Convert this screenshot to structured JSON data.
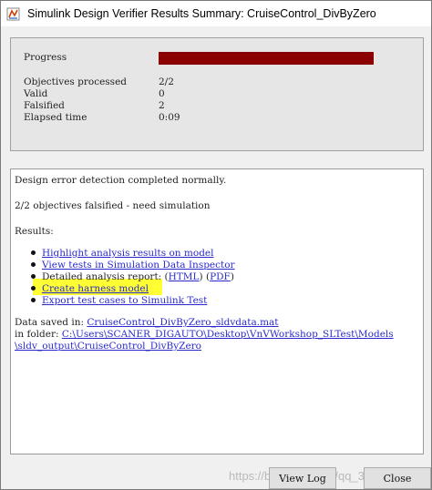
{
  "window": {
    "title": "Simulink Design Verifier Results Summary: CruiseControl_DivByZero",
    "icon": "simulink-icon"
  },
  "summary": {
    "progress_label": "Progress",
    "progress_fraction": 1.0,
    "progress_color": "#8b0000",
    "rows": [
      {
        "label": "Objectives processed",
        "value": "2/2"
      },
      {
        "label": "Valid",
        "value": "0"
      },
      {
        "label": "Falsified",
        "value": "2"
      },
      {
        "label": "Elapsed time",
        "value": "0:09"
      }
    ]
  },
  "log": {
    "line1": "Design error detection completed normally.",
    "line2": "2/2 objectives falsified - need simulation",
    "results_label": "Results:",
    "results": {
      "highlight": "Highlight analysis results on model",
      "view_tests": "View tests in Simulation Data Inspector",
      "report_prefix": "Detailed analysis report: (",
      "report_html": "HTML",
      "report_mid": ") (",
      "report_pdf": "PDF",
      "report_suffix": ")",
      "harness": "Create harness model",
      "export": "Export test cases to Simulink Test"
    },
    "data_saved_prefix": "Data saved in: ",
    "data_file": "CruiseControl_DivByZero_sldvdata.mat",
    "folder_prefix": "in folder: ",
    "folder_line1": "C:\\Users\\SCANER_DIGAUTO\\Desktop\\VnVWorkshop_SLTest\\Models",
    "folder_line2": "\\sldv_output\\CruiseControl_DivByZero",
    "highlight_color": "#ffff33"
  },
  "buttons": {
    "view_log": "View Log",
    "close": "Close"
  },
  "watermark": "https://blog.csdn.net/qq_36150699"
}
